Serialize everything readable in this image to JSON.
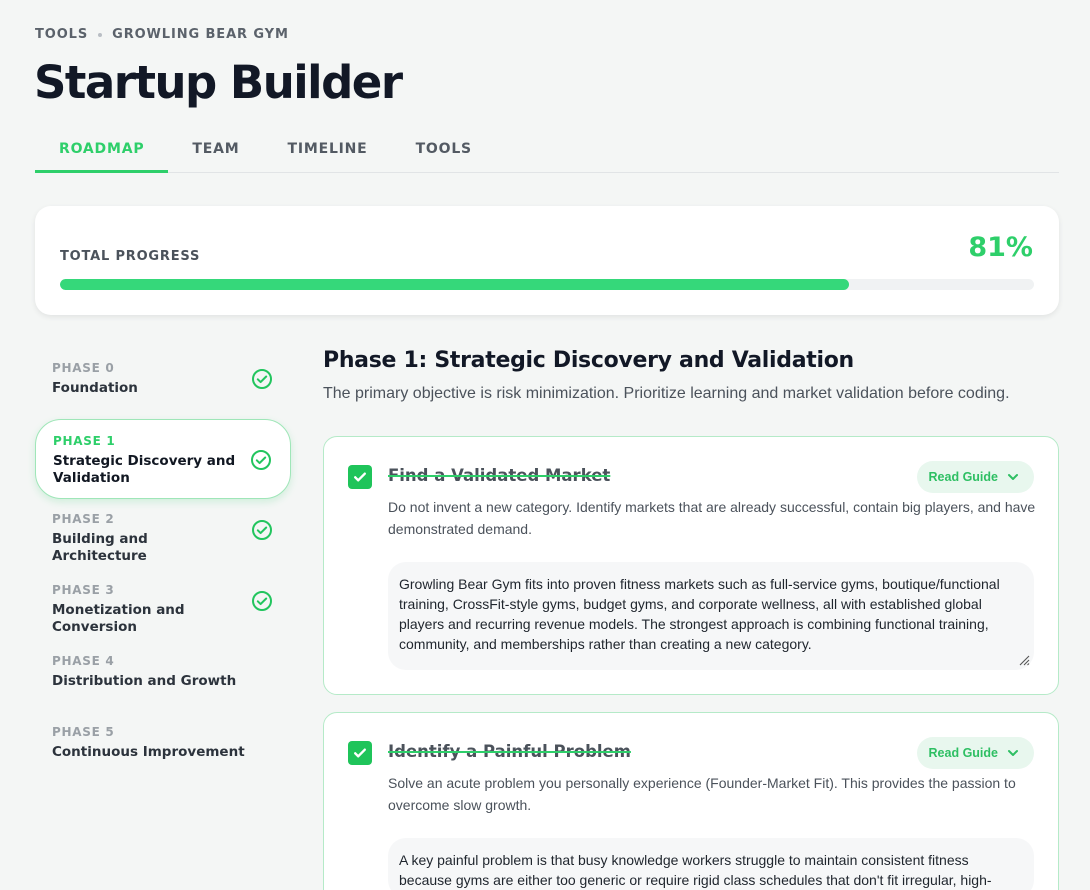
{
  "breadcrumb": {
    "root": "TOOLS",
    "current": "GROWLING BEAR GYM"
  },
  "page_title": "Startup Builder",
  "tabs": [
    {
      "label": "ROADMAP",
      "active": true
    },
    {
      "label": "TEAM"
    },
    {
      "label": "TIMELINE"
    },
    {
      "label": "TOOLS"
    }
  ],
  "progress": {
    "label": "TOTAL PROGRESS",
    "display": "81%",
    "value": 0.81,
    "accent": "#2ecf6a"
  },
  "phases": [
    {
      "num": "PHASE 0",
      "name": "Foundation",
      "done": true
    },
    {
      "num": "PHASE 1",
      "name": "Strategic Discovery and Validation",
      "done": true,
      "active": true
    },
    {
      "num": "PHASE 2",
      "name": "Building and Architecture",
      "done": true
    },
    {
      "num": "PHASE 3",
      "name": "Monetization and Conversion",
      "done": true
    },
    {
      "num": "PHASE 4",
      "name": "Distribution and Growth",
      "done": false
    },
    {
      "num": "PHASE 5",
      "name": "Continuous Improvement",
      "done": false
    }
  ],
  "main": {
    "title": "Phase 1: Strategic Discovery and Validation",
    "description": "The primary objective is risk minimization. Prioritize learning and market validation before coding.",
    "tasks": [
      {
        "title": "Find a Validated Market",
        "guide_label": "Read Guide",
        "description": "Do not invent a new category. Identify markets that are already successful, contain big players, and have demonstrated demand.",
        "note": "Growling Bear Gym fits into proven fitness markets such as full-service gyms, boutique/functional training, CrossFit-style gyms, budget gyms, and corporate wellness, all with established global players and recurring revenue models. The strongest approach is combining functional training, community, and memberships rather than creating a new category."
      },
      {
        "title": "Identify a Painful Problem",
        "guide_label": "Read Guide",
        "description": "Solve an acute problem you personally experience (Founder-Market Fit). This provides the passion to overcome slow growth.",
        "note": "A key painful problem is that busy knowledge workers struggle to maintain consistent fitness because gyms are either too generic or require rigid class schedules that don't fit irregular, high-"
      }
    ]
  }
}
